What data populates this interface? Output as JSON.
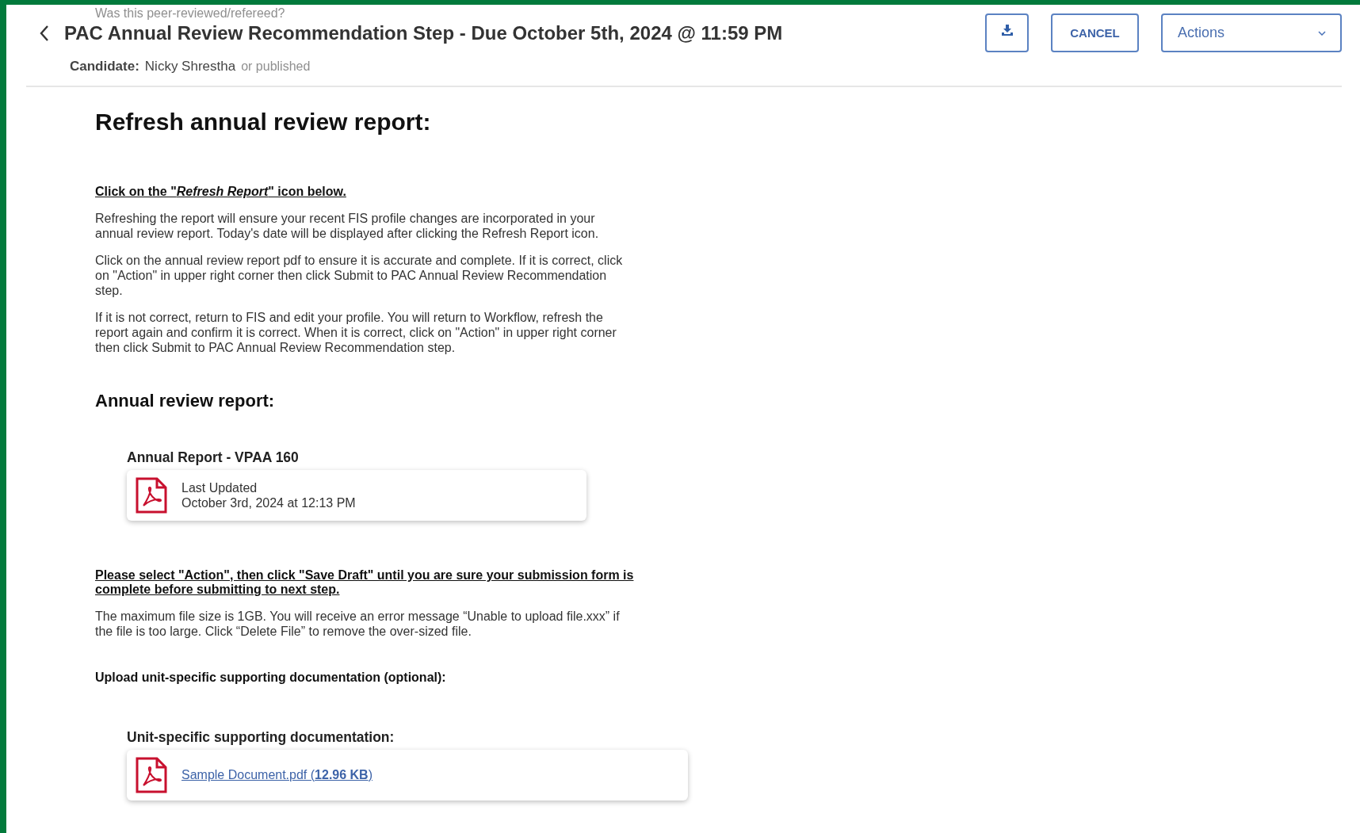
{
  "background_ghost_texts": [
    {
      "kind": "top",
      "text": "Was this peer-reviewed/refereed?"
    },
    {
      "kind": "inline",
      "text": "or published"
    }
  ],
  "header": {
    "title": "PAC Annual Review Recommendation Step - Due October 5th, 2024 @ 11:59 PM",
    "candidate_label": "Candidate:",
    "candidate_name": "Nicky Shrestha",
    "cancel_button": "CANCEL",
    "actions_dropdown": "Actions"
  },
  "content": {
    "heading": "Refresh annual review report:",
    "instruction_heading": "Click on the \"*Refresh Report*\" icon below.",
    "paragraphs": [
      "Refreshing the report will ensure your recent FIS profile changes are incorporated in your annual review report.  Today's date will be displayed after clicking the Refresh Report icon.",
      "Click on the annual review report pdf to ensure it is accurate and complete.  If it is correct,  click on \"Action\" in upper right corner then click Submit to PAC Annual Review Recommendation step.",
      "If it is not correct, return to FIS and edit your profile.  You will return to Workflow, refresh the report again and confirm it is correct.  When it is correct, click on \"Action\" in upper right corner then click Submit to PAC Annual Review Recommendation step."
    ],
    "report_heading": "Annual review report:",
    "report": {
      "label": "Annual Report - VPAA 160",
      "updated_label": "Last Updated",
      "updated_date": "October 3rd, 2024 at 12:13 PM"
    },
    "draft_notice": "Please select \"Action\", then click \"Save Draft\" until you are sure your submission form is complete before submitting to next step.",
    "size_note": "The maximum file size is 1GB.  You will receive an error message “Unable to upload file.xxx” if the file is too large.  Click “Delete File” to remove the over-sized file.",
    "upload_heading": "Upload unit-specific supporting documentation (optional):",
    "documentation": {
      "label": "Unit-specific supporting documentation:",
      "file_link": "Sample Document.pdf (**12.96 KB**)"
    }
  }
}
